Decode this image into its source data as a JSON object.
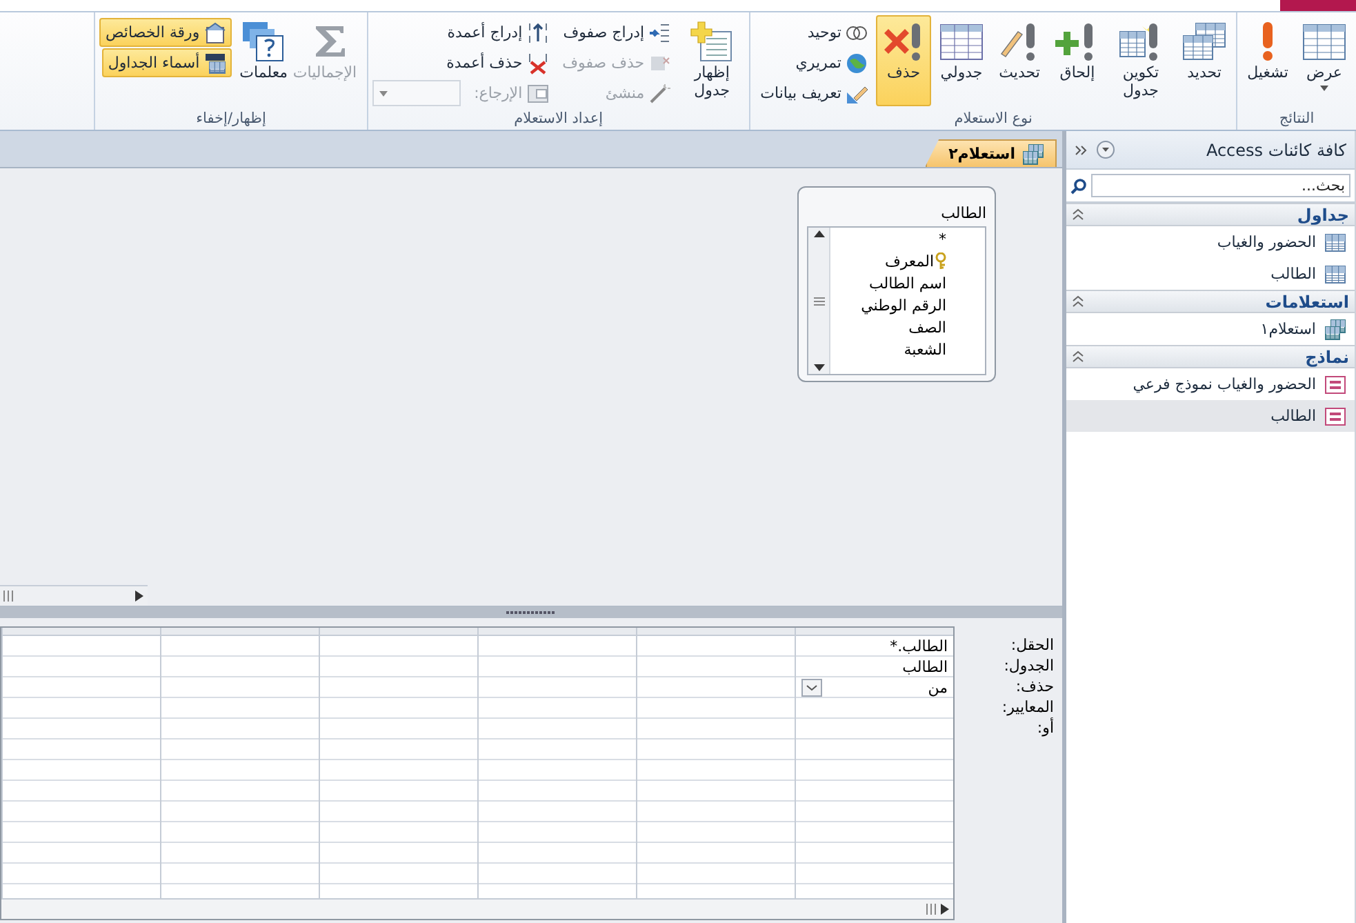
{
  "ribbon": {
    "groups": [
      {
        "label": "النتائج",
        "buttons": [
          {
            "label": "عرض",
            "kind": "datasheet",
            "dropdown": true
          },
          {
            "label": "تشغيل",
            "kind": "run"
          }
        ]
      },
      {
        "label": "نوع الاستعلام",
        "buttons": [
          {
            "label": "تحديد",
            "kind": "select",
            "selected": false
          },
          {
            "label": "تكوين جدول",
            "kind": "maketable",
            "selected": false
          },
          {
            "label": "إلحاق",
            "kind": "append",
            "selected": false
          },
          {
            "label": "تحديث",
            "kind": "update",
            "selected": false
          },
          {
            "label": "جدولي",
            "kind": "crosstab",
            "selected": false
          },
          {
            "label": "حذف",
            "kind": "delete",
            "selected": true
          },
          {
            "kind": "stack",
            "items": [
              {
                "label": "توحيد",
                "kind": "union",
                "disabled": false
              },
              {
                "label": "تمريري",
                "kind": "passthrough",
                "disabled": false
              },
              {
                "label": "تعريف بيانات",
                "kind": "definition",
                "disabled": false
              }
            ]
          }
        ]
      },
      {
        "label": "إعداد الاستعلام",
        "buttons": [
          {
            "label": "إظهار جدول",
            "kind": "showtable"
          },
          {
            "kind": "stack",
            "items": [
              {
                "label": "إدراج صفوف",
                "kind": "insertrows",
                "disabled": false
              },
              {
                "label": "حذف صفوف",
                "kind": "deleterows",
                "disabled": true
              },
              {
                "label": "منشئ",
                "kind": "builder",
                "disabled": true
              }
            ]
          },
          {
            "kind": "stack",
            "items": [
              {
                "label": "إدراج أعمدة",
                "kind": "insertcolumns",
                "disabled": false
              },
              {
                "label": "حذف أعمدة",
                "kind": "deletecolumns",
                "disabled": false
              },
              {
                "label": "الإرجاع:",
                "kind": "return",
                "disabled": true,
                "combo": true
              }
            ]
          }
        ]
      },
      {
        "label": "إظهار/إخفاء",
        "buttons": [
          {
            "label": "الإجماليات",
            "kind": "totals",
            "disabled": true
          },
          {
            "label": "معلمات",
            "kind": "parameters",
            "disabled": false
          },
          {
            "kind": "stack",
            "items": [
              {
                "label": "ورقة الخصائص",
                "kind": "propertysheet",
                "disabled": false,
                "selected": true
              },
              {
                "label": "أسماء الجداول",
                "kind": "tablenames",
                "disabled": false,
                "selected": true
              }
            ]
          }
        ]
      }
    ]
  },
  "nav_pane": {
    "title": "كافة كائنات Access",
    "search": {
      "placeholder": "بحث..."
    },
    "groups": [
      {
        "title": "جداول",
        "items": [
          {
            "label": "الحضور والغياب",
            "kind": "table",
            "selected": false
          },
          {
            "label": "الطالب",
            "kind": "table",
            "selected": false
          }
        ]
      },
      {
        "title": "استعلامات",
        "items": [
          {
            "label": "استعلام١",
            "kind": "query",
            "selected": false
          }
        ]
      },
      {
        "title": "نماذج",
        "items": [
          {
            "label": "الحضور والغياب نموذج فرعي",
            "kind": "form",
            "selected": false
          },
          {
            "label": "الطالب",
            "kind": "form",
            "selected": true
          }
        ]
      }
    ]
  },
  "document_tabs": [
    {
      "label": "استعلام٢",
      "selected": true
    }
  ],
  "table_box": {
    "title": "الطالب",
    "fields": [
      {
        "name": "*",
        "key": false
      },
      {
        "name": "المعرف",
        "key": true
      },
      {
        "name": "اسم الطالب",
        "key": false
      },
      {
        "name": "الرقم الوطني",
        "key": false
      },
      {
        "name": "الصف",
        "key": false
      },
      {
        "name": "الشعبة",
        "key": false
      }
    ]
  },
  "design_grid": {
    "row_labels": [
      "الحقل:",
      "الجدول:",
      "حذف:",
      "المعايير:",
      "أو:"
    ],
    "columns": [
      {
        "field": "الطالب.*",
        "table": "الطالب",
        "delete": "من"
      }
    ]
  }
}
